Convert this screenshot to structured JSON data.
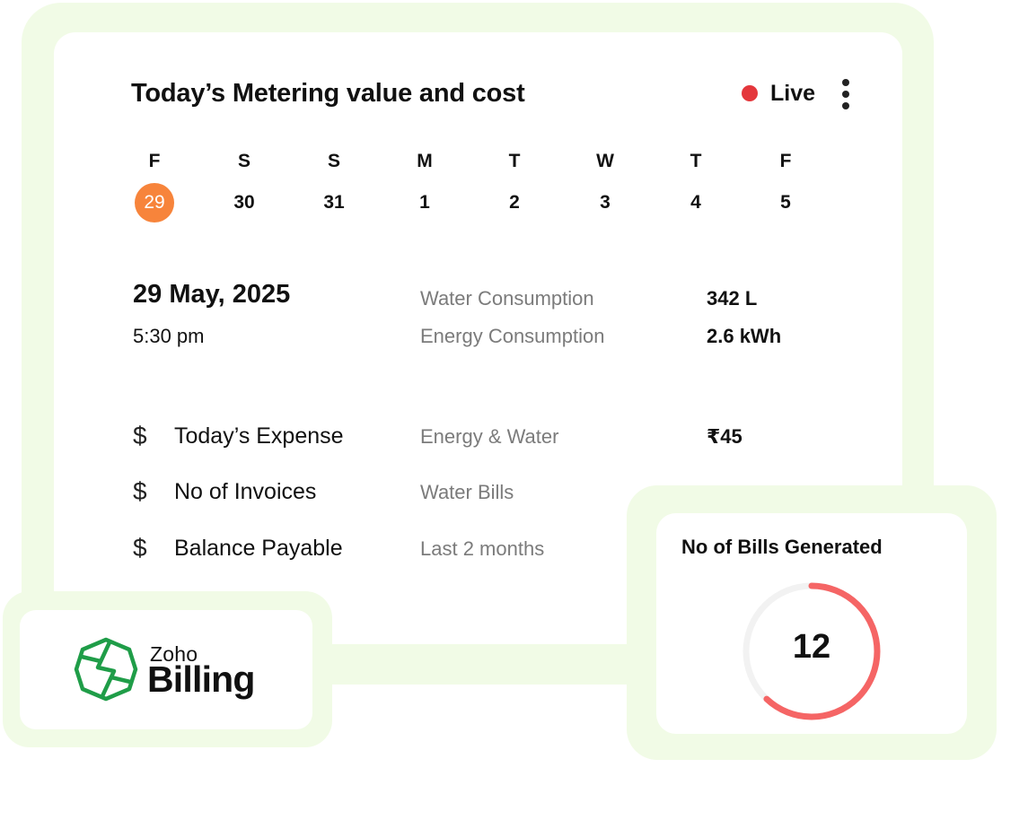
{
  "card": {
    "title": "Today’s Metering value and cost",
    "live_label": "Live",
    "live_color": "#e4373c",
    "menu_icon": "more-vertical-icon"
  },
  "calendar": {
    "days": [
      {
        "weekday": "F",
        "date": "29",
        "selected": true
      },
      {
        "weekday": "S",
        "date": "30",
        "selected": false
      },
      {
        "weekday": "S",
        "date": "31",
        "selected": false
      },
      {
        "weekday": "M",
        "date": "1",
        "selected": false
      },
      {
        "weekday": "T",
        "date": "2",
        "selected": false
      },
      {
        "weekday": "W",
        "date": "3",
        "selected": false
      },
      {
        "weekday": "T",
        "date": "4",
        "selected": false
      },
      {
        "weekday": "F",
        "date": "5",
        "selected": false
      }
    ],
    "selected_color": "#f7843b"
  },
  "reading": {
    "date": "29 May, 2025",
    "time": "5:30 pm",
    "metrics": [
      {
        "label": "Water Consumption",
        "value": "342 L"
      },
      {
        "label": "Energy Consumption",
        "value": "2.6 kWh"
      }
    ]
  },
  "finance": {
    "rows": [
      {
        "icon": "$",
        "title": "Today’s Expense",
        "detail": "Energy & Water",
        "value": "₹45"
      },
      {
        "icon": "$",
        "title": "No of Invoices",
        "detail": "Water Bills",
        "value": ""
      },
      {
        "icon": "$",
        "title": "Balance Payable",
        "detail": "Last 2 months",
        "value": ""
      }
    ]
  },
  "logo": {
    "zoho": "Zoho",
    "billing": "Billing",
    "brand_color": "#1f9d48"
  },
  "bills": {
    "title": "No of Bills Generated",
    "count": "12",
    "progress_fraction": 0.62,
    "ring_color": "#f56565",
    "track_color": "#f2f2f2"
  },
  "theme": {
    "frame_color": "#f1fbe6"
  }
}
